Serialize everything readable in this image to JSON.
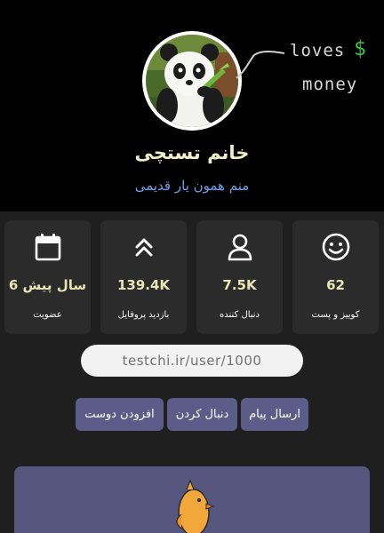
{
  "profile": {
    "name": "خانم تستچی",
    "bio": "منم همون یار قدیمی",
    "avatar_alt": "panda-avatar",
    "doodle": {
      "word1": "loves",
      "symbol": "$",
      "word2": "money"
    }
  },
  "stats": [
    {
      "icon": "smiley-icon",
      "value": "62",
      "label": "کوییز و پست"
    },
    {
      "icon": "user-icon",
      "value": "7.5K",
      "label": "دنبال کننده"
    },
    {
      "icon": "double-chevron-up-icon",
      "value": "139.4K",
      "label": "بازدید پروفایل"
    },
    {
      "icon": "calendar-icon",
      "value": "6 سال پیش",
      "label": "عضویت"
    }
  ],
  "profile_url": "testchi.ir/user/1000",
  "actions": {
    "send_message": "ارسال پیام",
    "follow": "دنبال کردن",
    "add_friend": "افزودن دوست"
  },
  "colors": {
    "accent": "#5c5c88",
    "name": "#f2f0c8",
    "bio": "#6fa0e6",
    "stat_value": "#e9e6b6",
    "card": "#2b2b2b"
  }
}
